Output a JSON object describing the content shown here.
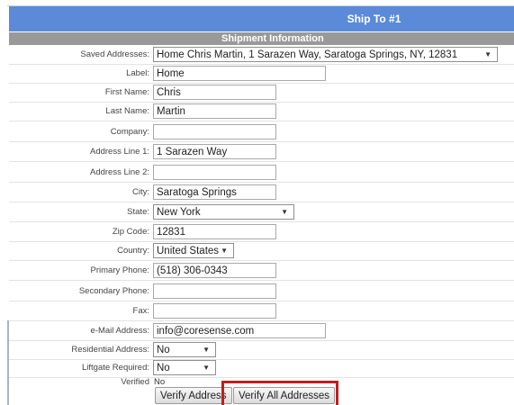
{
  "section": {
    "title": "Ship To #1",
    "subtitle": "Shipment Information"
  },
  "fields": {
    "saved_addresses": {
      "label": "Saved Addresses:",
      "value": "Home Chris Martin, 1 Sarazen Way, Saratoga Springs, NY, 12831"
    },
    "label": {
      "label": "Label:",
      "value": "Home"
    },
    "first_name": {
      "label": "First Name:",
      "value": "Chris"
    },
    "last_name": {
      "label": "Last Name:",
      "value": "Martin"
    },
    "company": {
      "label": "Company:",
      "value": ""
    },
    "address_line_1": {
      "label": "Address Line 1:",
      "value": "1 Sarazen Way"
    },
    "address_line_2": {
      "label": "Address Line 2:",
      "value": ""
    },
    "city": {
      "label": "City:",
      "value": "Saratoga Springs"
    },
    "state": {
      "label": "State:",
      "value": "New York"
    },
    "zip_code": {
      "label": "Zip Code:",
      "value": "12831"
    },
    "country": {
      "label": "Country:",
      "value": "United States"
    },
    "primary_phone": {
      "label": "Primary Phone:",
      "value": "(518) 306-0343"
    },
    "secondary_phone": {
      "label": "Secondary Phone:",
      "value": ""
    },
    "fax": {
      "label": "Fax:",
      "value": ""
    },
    "email": {
      "label": "e-Mail Address:",
      "value": "info@coresense.com"
    },
    "residential": {
      "label": "Residential Address:",
      "value": "No"
    },
    "liftgate": {
      "label": "Liftgate Required:",
      "value": "No"
    },
    "verified": {
      "label": "Verified",
      "value": "No"
    }
  },
  "buttons": {
    "verify_address": "Verify Address",
    "verify_all": "Verify All Addresses"
  },
  "icons": {
    "dropdown": "chevron-down-icon",
    "caret_glyph": "▼"
  },
  "colors": {
    "header_blue": "#5b8ad8",
    "subheader_gray": "#999999",
    "highlight_red": "#c21d1d"
  }
}
